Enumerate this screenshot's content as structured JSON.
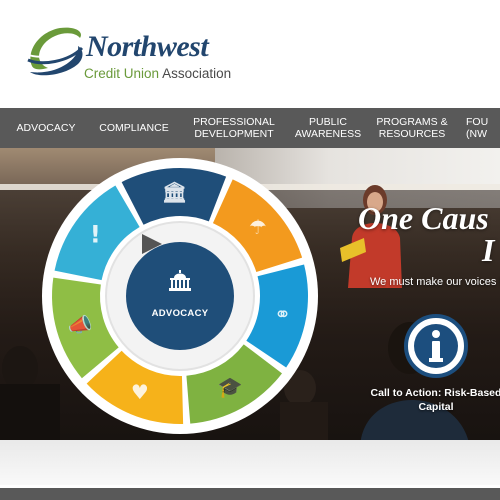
{
  "brand": {
    "name": "Northwest",
    "subtitle_part1": "Credit Union",
    "subtitle_part2": "Association",
    "colors": {
      "navy": "#22466e",
      "green": "#6a9a3a"
    }
  },
  "nav": {
    "items": [
      {
        "line1": "ADVOCACY",
        "line2": ""
      },
      {
        "line1": "COMPLIANCE",
        "line2": ""
      },
      {
        "line1": "PROFESSIONAL",
        "line2": "DEVELOPMENT"
      },
      {
        "line1": "PUBLIC",
        "line2": "AWARENESS"
      },
      {
        "line1": "PROGRAMS &",
        "line2": "RESOURCES"
      },
      {
        "line1": "FOU",
        "line2": "(NW"
      }
    ]
  },
  "hero": {
    "headline_line1": "One Caus",
    "headline_line2": "I",
    "subline": "We must make our voices lo",
    "cta": "Call to Action: Risk-Based Capital"
  },
  "wheel": {
    "center_label": "ADVOCACY",
    "segments": [
      {
        "name": "advocacy",
        "icon": "capitol-icon",
        "color": "#1f4e79"
      },
      {
        "name": "public-awareness",
        "icon": "umbrella-icon",
        "color": "#f39a1e"
      },
      {
        "name": "resources",
        "icon": "link-icon",
        "color": "#1a9ad6"
      },
      {
        "name": "professional-development",
        "icon": "graduation-cap-icon",
        "color": "#7fb241"
      },
      {
        "name": "foundation",
        "icon": "heart-icon",
        "color": "#f6b21a"
      },
      {
        "name": "awareness",
        "icon": "megaphone-icon",
        "color": "#8fbe45"
      },
      {
        "name": "compliance",
        "icon": "exclamation-icon",
        "color": "#35b0d6"
      }
    ]
  }
}
